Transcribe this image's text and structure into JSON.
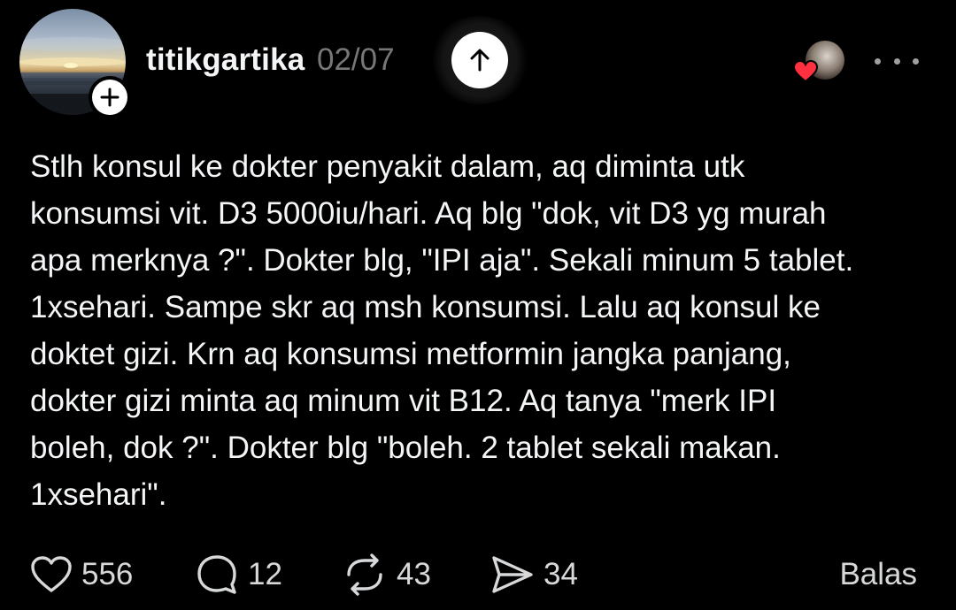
{
  "post": {
    "username": "titikgartika",
    "date": "02/07",
    "text": "Stlh konsul ke dokter penyakit dalam, aq diminta utk\nkonsumsi vit. D3 5000iu/hari. Aq blg \"dok, vit D3 yg murah\napa merknya ?\". Dokter blg, \"IPI aja\". Sekali minum 5 tablet.\n1xsehari. Sampe skr aq msh konsumsi. Lalu aq konsul ke\ndoktet gizi. Krn aq konsumsi metformin jangka panjang,\ndokter gizi minta aq minum vit B12. Aq tanya \"merk IPI\nboleh, dok ?\". Dokter blg \"boleh. 2 tablet sekali makan.\n1xsehari\"."
  },
  "actions": {
    "likes": "556",
    "comments": "12",
    "reposts": "43",
    "shares": "34",
    "reply_label": "Balas"
  },
  "icons": {
    "follow": "plus-icon",
    "scroll_up": "arrow-up-icon",
    "liked_by": "heart-icon",
    "more": "more-horizontal-icon",
    "like": "heart-outline-icon",
    "comment": "comment-bubble-icon",
    "repost": "repost-icon",
    "share": "send-icon"
  },
  "colors": {
    "background": "#000000",
    "text_primary": "#f3f5f7",
    "text_secondary": "#777777",
    "liked_heart": "#ff3040"
  }
}
